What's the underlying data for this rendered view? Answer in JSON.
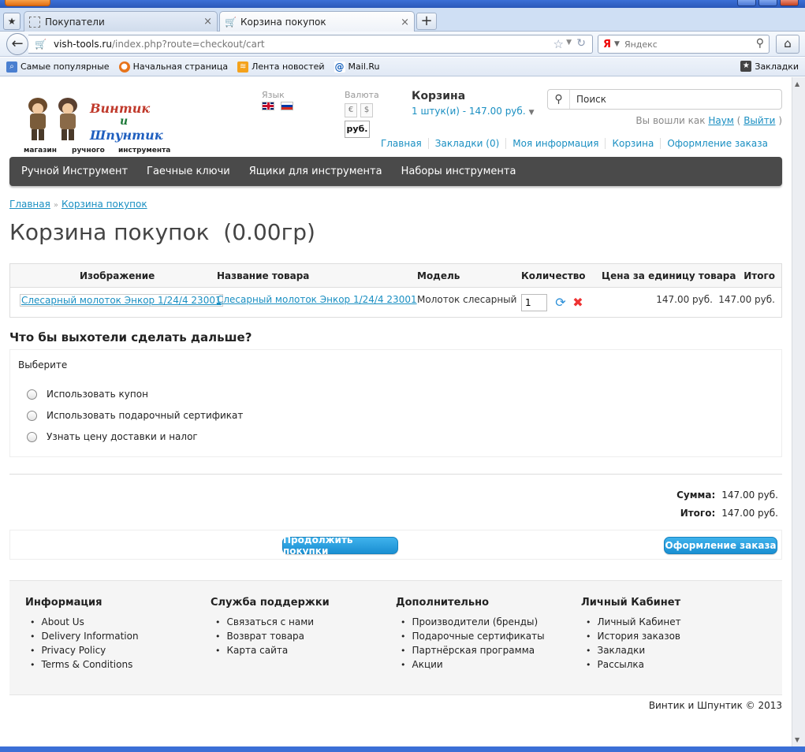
{
  "browser": {
    "tabs": [
      {
        "title": "Покупатели"
      },
      {
        "title": "Корзина покупок"
      }
    ],
    "url_host": "vish-tools.ru",
    "url_path": "/index.php?route=checkout/cart",
    "search_placeholder": "Яндекс",
    "bookmarks": [
      "Самые популярные",
      "Начальная страница",
      "Лента новостей",
      "Mail.Ru"
    ],
    "bookmarks_right": "Закладки"
  },
  "header": {
    "logo_words": [
      "Винтик",
      "и",
      "Шпунтик"
    ],
    "logo_tagline": [
      "магазин",
      "ручного",
      "инструмента"
    ],
    "language_label": "Язык",
    "currency_label": "Валюта",
    "currency_options": [
      "€",
      "$"
    ],
    "currency_active": "руб.",
    "cart_title": "Корзина",
    "cart_summary": "1 штук(и) - 147.00 руб.",
    "search_value": "Поиск",
    "welcome_prefix": "Вы вошли как",
    "user_name": "Наум",
    "logout_open": "(",
    "logout": "Выйти",
    "logout_close": ")",
    "top_links": [
      "Главная",
      "Закладки (0)",
      "Моя информация",
      "Корзина",
      "Оформление заказа"
    ]
  },
  "menu": [
    "Ручной Инструмент",
    "Гаечные ключи",
    "Ящики для инструмента",
    "Наборы инструмента"
  ],
  "breadcrumb": {
    "home": "Главная",
    "sep": "»",
    "current": "Корзина покупок"
  },
  "page_title": "Корзина покупок  (0.00гр)",
  "cart_table": {
    "headers": {
      "image": "Изображение",
      "name": "Название товара",
      "model": "Модель",
      "qty": "Количество",
      "price": "Цена за единицу товара",
      "total": "Итого"
    },
    "rows": [
      {
        "image_link": "Слесарный молоток Энкор 1/24/4 23001",
        "name": "Слесарный молоток Энкор 1/24/4 23001",
        "model": "Молоток слесарный",
        "qty": "1",
        "price": "147.00 руб.",
        "total": "147.00 руб."
      }
    ]
  },
  "next": {
    "heading": "Что бы выхотели сделать дальше?",
    "choose": "Выберите",
    "options": [
      "Использовать купон",
      "Использовать подарочный сертификат",
      "Узнать цену доставки и налог"
    ]
  },
  "totals": [
    {
      "label": "Сумма:",
      "value": "147.00 руб."
    },
    {
      "label": "Итого:",
      "value": "147.00 руб."
    }
  ],
  "buttons": {
    "continue": "Продолжить покупки",
    "checkout": "Оформление заказа"
  },
  "footer": {
    "columns": [
      {
        "title": "Информация",
        "items": [
          "About Us",
          "Delivery Information",
          "Privacy Policy",
          "Terms & Conditions"
        ]
      },
      {
        "title": "Служба поддержки",
        "items": [
          "Связаться с нами",
          "Возврат товара",
          "Карта сайта"
        ]
      },
      {
        "title": "Дополнительно",
        "items": [
          "Производители (бренды)",
          "Подарочные сертификаты",
          "Партнёрская программа",
          "Акции"
        ]
      },
      {
        "title": "Личный Кабинет",
        "items": [
          "Личный Кабинет",
          "История заказов",
          "Закладки",
          "Рассылка"
        ]
      }
    ],
    "copyright": "Винтик и Шпунтик © 2013"
  },
  "colors": {
    "link": "#1a8fc2",
    "menu_bg": "#4a4a4a",
    "button": "#1a8fd2"
  }
}
